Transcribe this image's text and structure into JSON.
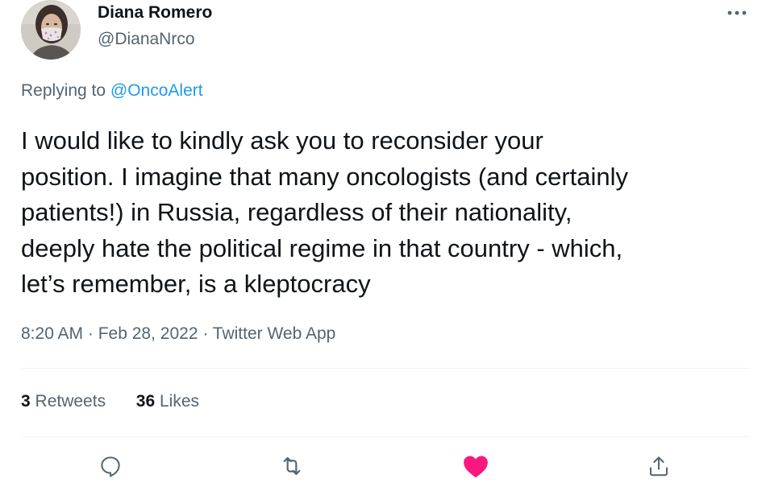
{
  "author": {
    "name": "Diana Romero",
    "handle": "@DianaNrco"
  },
  "reply": {
    "prefix": "Replying to",
    "mention": "@OncoAlert"
  },
  "tweet": {
    "lines": [
      "I would like to kindly ask you to reconsider your",
      "position. I imagine that many oncologists (and certainly",
      "patients!) in Russia, regardless of their nationality,",
      "deeply hate the political regime in that country - which,",
      "let’s remember, is a kleptocracy"
    ]
  },
  "meta": {
    "time": "8:20 AM",
    "separator": " · ",
    "date": "Feb 28, 2022",
    "source": "Twitter Web App"
  },
  "stats": {
    "retweets_count": "3",
    "retweets_label": "Retweets",
    "likes_count": "36",
    "likes_label": "Likes"
  },
  "icons": {
    "reply": "reply-icon",
    "retweet": "retweet-icon",
    "like": "heart-icon",
    "share": "share-icon",
    "more": "more-icon"
  },
  "colors": {
    "link": "#1d9bf0",
    "like_active": "#f91880",
    "secondary_text": "#536471",
    "icon_gray": "#536471"
  }
}
